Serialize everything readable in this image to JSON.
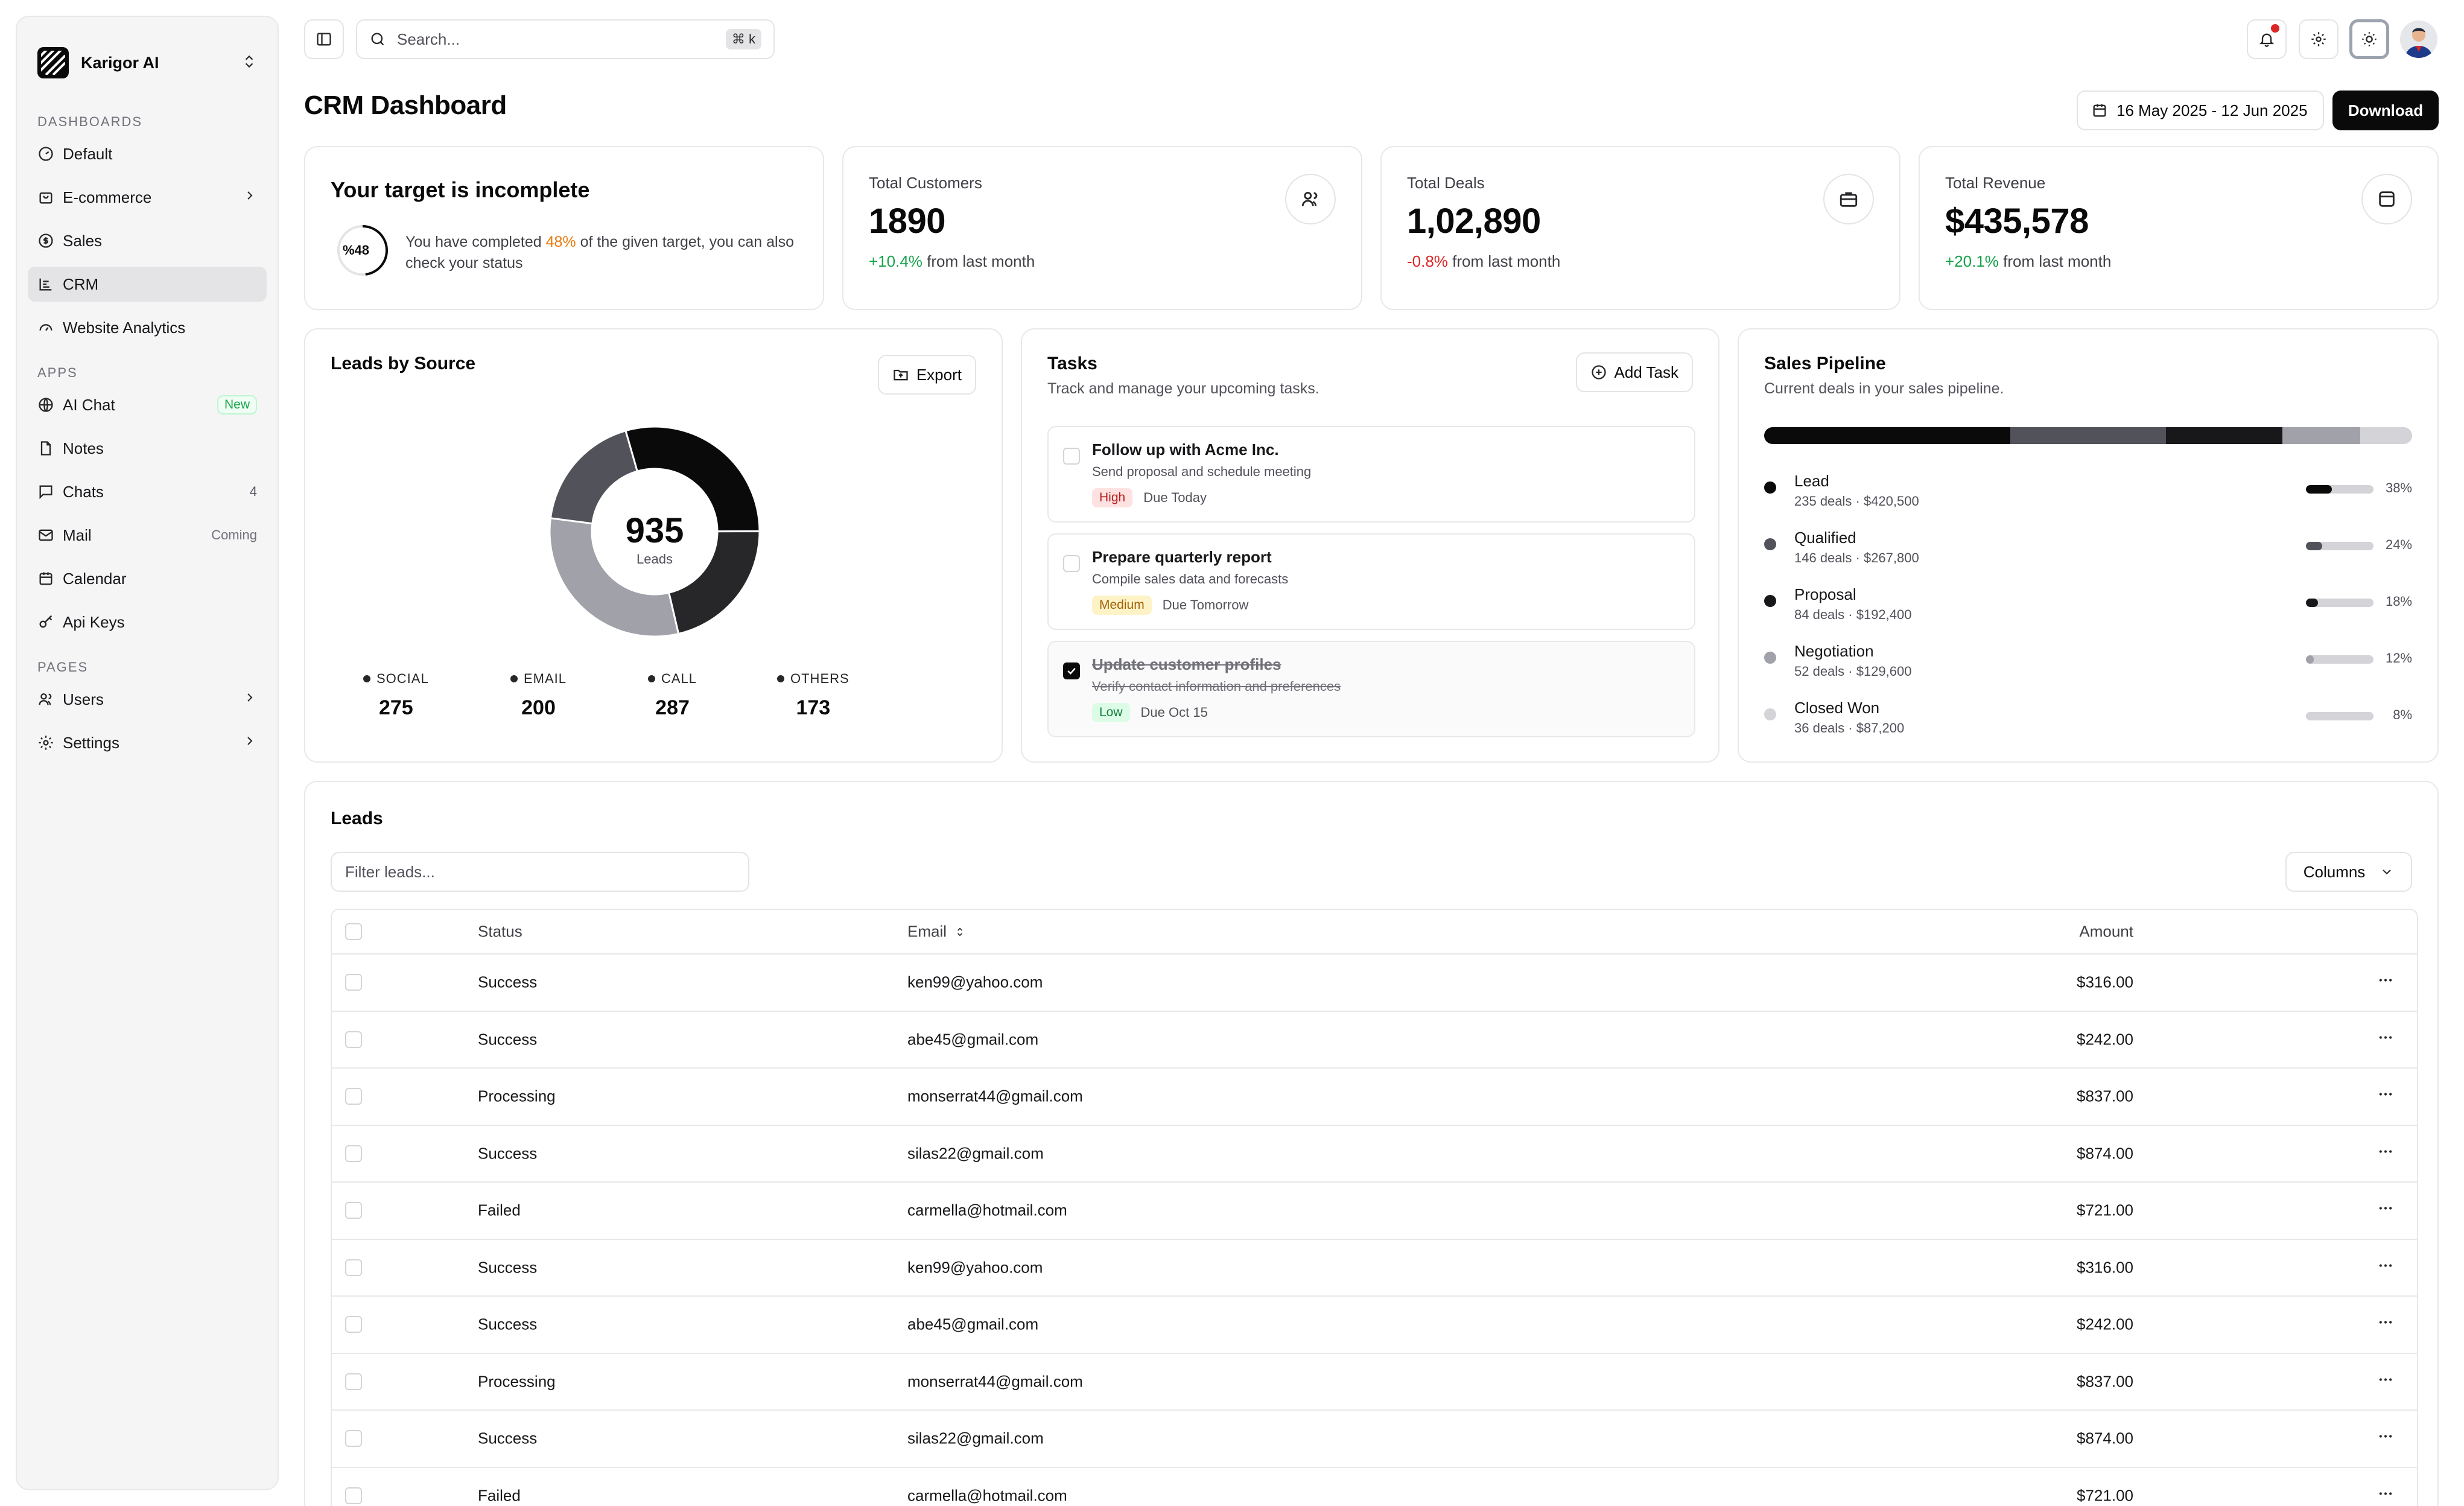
{
  "sidebar": {
    "brand": "Karigor AI",
    "sections": [
      {
        "title": "DASHBOARDS"
      },
      {
        "title": "APPS"
      },
      {
        "title": "PAGES"
      }
    ],
    "items": {
      "default": "Default",
      "ecommerce": "E-commerce",
      "sales": "Sales",
      "crm": "CRM",
      "analytics": "Website Analytics",
      "aichat": "AI Chat",
      "aichat_badge": "New",
      "notes": "Notes",
      "chats": "Chats",
      "chats_count": "4",
      "mail": "Mail",
      "mail_badge": "Coming",
      "calendar": "Calendar",
      "apikeys": "Api Keys",
      "users": "Users",
      "settings": "Settings"
    }
  },
  "topbar": {
    "search_placeholder": "Search...",
    "search_shortcut": "⌘ k"
  },
  "header": {
    "title": "CRM Dashboard",
    "date_range": "16 May 2025 - 12 Jun 2025",
    "download_label": "Download"
  },
  "target": {
    "title": "Your target is incomplete",
    "badge": "%48",
    "progress": 48,
    "text_before": "You have completed ",
    "highlight": "48%",
    "text_after": " of the given target, you can also check your status"
  },
  "stats": [
    {
      "label": "Total Customers",
      "value": "1890",
      "delta": "+10.4%",
      "delta_text": " from last month",
      "icon": "users-icon"
    },
    {
      "label": "Total Deals",
      "value": "1,02,890",
      "delta": "-0.8%",
      "delta_text": " from last month",
      "icon": "briefcase-icon"
    },
    {
      "label": "Total Revenue",
      "value": "$435,578",
      "delta": "+20.1%",
      "delta_text": " from last month",
      "icon": "wallet-icon"
    }
  ],
  "leads_source": {
    "title": "Leads by Source",
    "export_label": "Export",
    "center_value": "935",
    "center_label": "Leads"
  },
  "chart_data": {
    "type": "pie",
    "categories": [
      "SOCIAL",
      "EMAIL",
      "CALL",
      "OTHERS"
    ],
    "values": [
      275,
      200,
      287,
      173
    ],
    "colors": [
      "#0a0a0a",
      "#27272a",
      "#a1a1aa",
      "#52525b"
    ],
    "title": "Leads by Source"
  },
  "tasks": {
    "title": "Tasks",
    "subtitle": "Track and manage your upcoming tasks.",
    "add_label": "Add Task",
    "items": [
      {
        "title": "Follow up with Acme Inc.",
        "desc": "Send proposal and schedule meeting",
        "priority": "High",
        "due": "Due Today",
        "done": false
      },
      {
        "title": "Prepare quarterly report",
        "desc": "Compile sales data and forecasts",
        "priority": "Medium",
        "due": "Due Tomorrow",
        "done": false
      },
      {
        "title": "Update customer profiles",
        "desc": "Verify contact information and preferences",
        "priority": "Low",
        "due": "Due Oct 15",
        "done": true
      }
    ]
  },
  "pipeline": {
    "title": "Sales Pipeline",
    "subtitle": "Current deals in your sales pipeline.",
    "stages": [
      {
        "name": "Lead",
        "info": "235 deals · $420,500",
        "pct": "38%",
        "value": 38,
        "color": "#0a0a0a"
      },
      {
        "name": "Qualified",
        "info": "146 deals · $267,800",
        "pct": "24%",
        "value": 24,
        "color": "#52525b"
      },
      {
        "name": "Proposal",
        "info": "84 deals · $192,400",
        "pct": "18%",
        "value": 18,
        "color": "#18181b"
      },
      {
        "name": "Negotiation",
        "info": "52 deals · $129,600",
        "pct": "12%",
        "value": 12,
        "color": "#a1a1aa"
      },
      {
        "name": "Closed Won",
        "info": "36 deals · $87,200",
        "pct": "8%",
        "value": 8,
        "color": "#d4d4d8"
      }
    ]
  },
  "leads_table": {
    "title": "Leads",
    "filter_placeholder": "Filter leads...",
    "columns_label": "Columns",
    "headers": {
      "status": "Status",
      "email": "Email",
      "amount": "Amount"
    },
    "rows": [
      {
        "status": "Success",
        "email": "ken99@yahoo.com",
        "amount": "$316.00"
      },
      {
        "status": "Success",
        "email": "abe45@gmail.com",
        "amount": "$242.00"
      },
      {
        "status": "Processing",
        "email": "monserrat44@gmail.com",
        "amount": "$837.00"
      },
      {
        "status": "Success",
        "email": "silas22@gmail.com",
        "amount": "$874.00"
      },
      {
        "status": "Failed",
        "email": "carmella@hotmail.com",
        "amount": "$721.00"
      },
      {
        "status": "Success",
        "email": "ken99@yahoo.com",
        "amount": "$316.00"
      },
      {
        "status": "Success",
        "email": "abe45@gmail.com",
        "amount": "$242.00"
      },
      {
        "status": "Processing",
        "email": "monserrat44@gmail.com",
        "amount": "$837.00"
      },
      {
        "status": "Success",
        "email": "silas22@gmail.com",
        "amount": "$874.00"
      },
      {
        "status": "Failed",
        "email": "carmella@hotmail.com",
        "amount": "$721.00"
      }
    ]
  }
}
